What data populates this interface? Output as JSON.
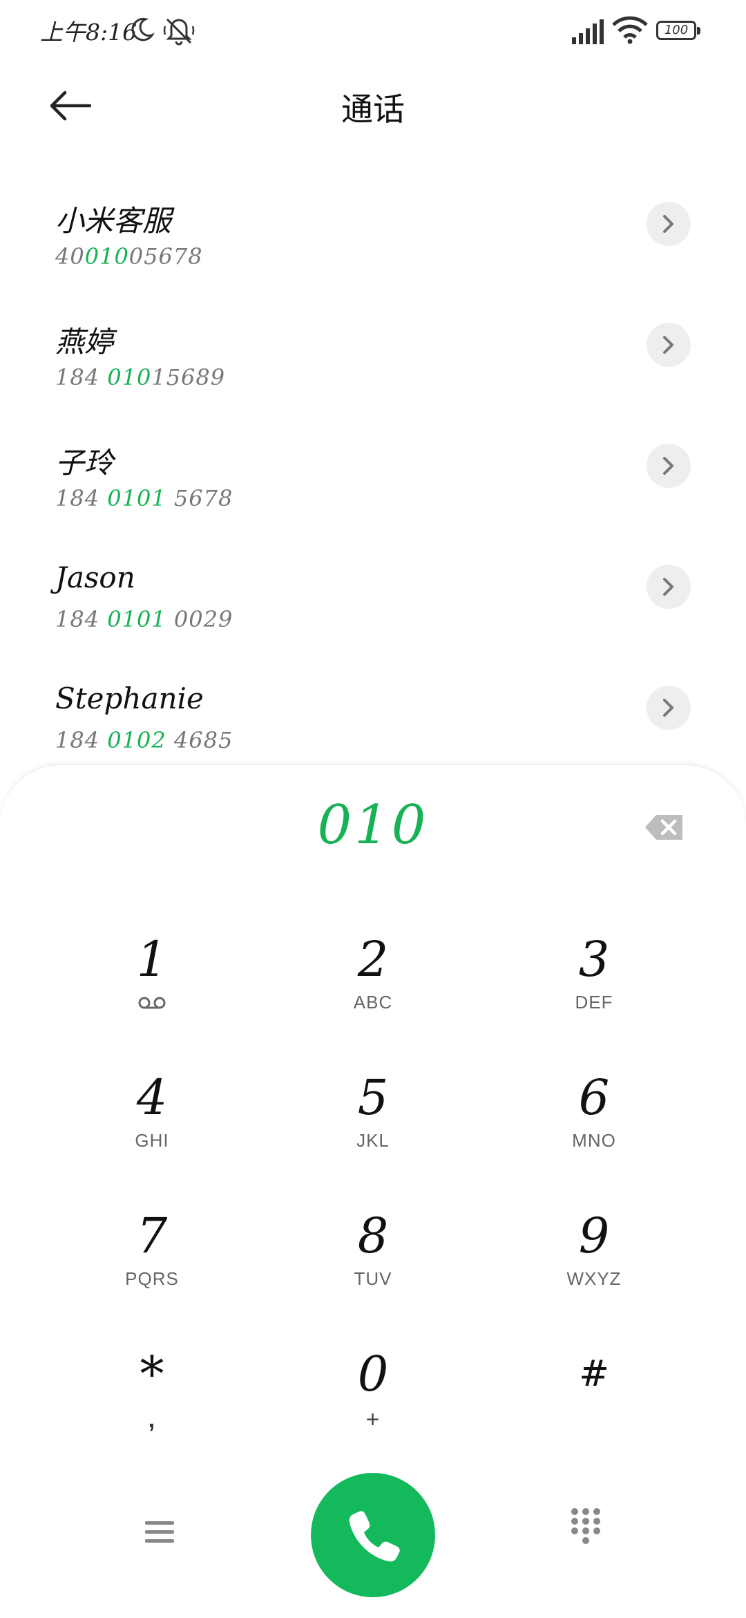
{
  "status_bar": {
    "time": "上午8:16",
    "battery_level": "100",
    "icons": [
      "moon-icon",
      "mute-icon",
      "signal-icon",
      "wifi-icon",
      "battery-icon"
    ]
  },
  "header": {
    "title": "通话",
    "back_icon": "back-arrow-icon"
  },
  "contacts": [
    {
      "name": "小米客服",
      "number_pre": "40",
      "number_match": "010",
      "number_post": "05678"
    },
    {
      "name": "燕婷",
      "number_pre": "184 ",
      "number_match": "010",
      "number_post": "15689"
    },
    {
      "name": "子玲",
      "number_pre": "184 ",
      "number_match": "0101",
      "number_post": " 5678"
    },
    {
      "name": "Jason",
      "number_pre": "184 ",
      "number_match": "0101",
      "number_post": " 0029"
    },
    {
      "name": "Stephanie",
      "number_pre": "184 ",
      "number_match": "0102",
      "number_post": " 4685"
    }
  ],
  "dialer": {
    "input": "010",
    "keys": [
      {
        "digit": "1",
        "letters": ""
      },
      {
        "digit": "2",
        "letters": "ABC"
      },
      {
        "digit": "3",
        "letters": "DEF"
      },
      {
        "digit": "4",
        "letters": "GHI"
      },
      {
        "digit": "5",
        "letters": "JKL"
      },
      {
        "digit": "6",
        "letters": "MNO"
      },
      {
        "digit": "7",
        "letters": "PQRS"
      },
      {
        "digit": "8",
        "letters": "TUV"
      },
      {
        "digit": "9",
        "letters": "WXYZ"
      },
      {
        "digit": "*",
        "letters": ","
      },
      {
        "digit": "0",
        "letters": "+"
      },
      {
        "digit": "#",
        "letters": ""
      }
    ]
  },
  "colors": {
    "accent": "#16b254",
    "call_button": "#13b95a",
    "arrow_bg": "#eeeeee"
  }
}
